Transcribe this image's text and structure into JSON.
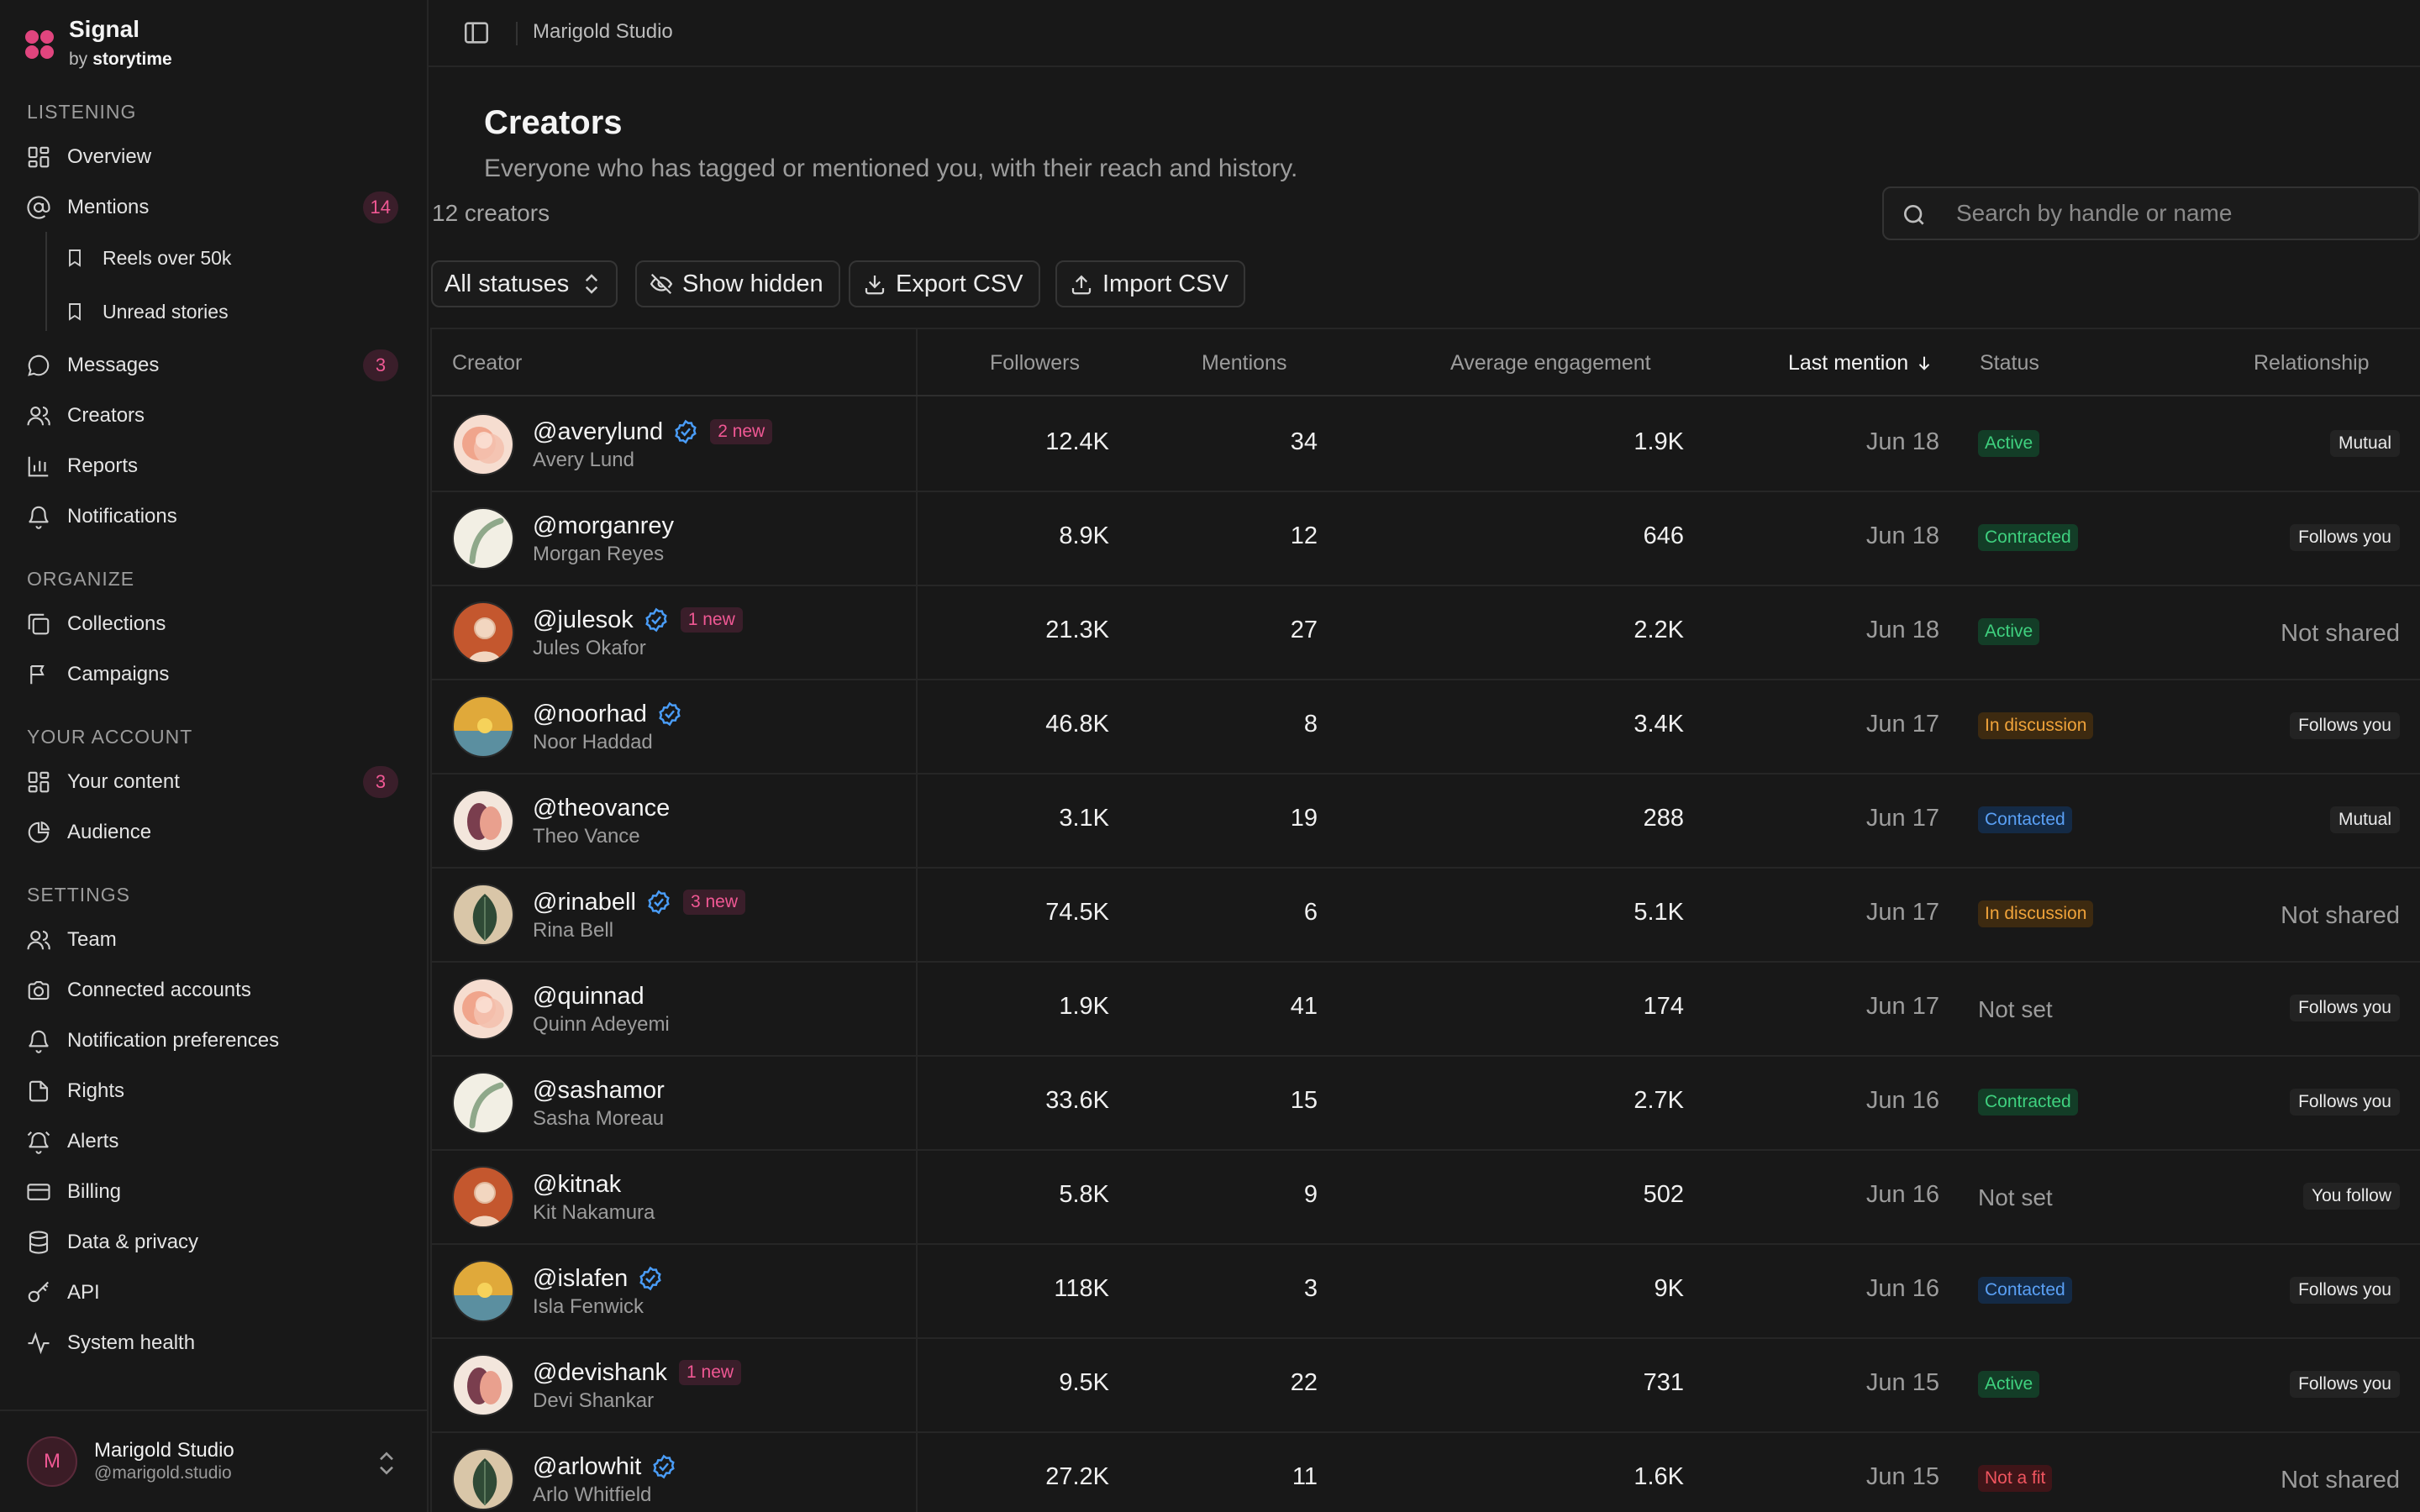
{
  "brand": {
    "name": "Signal",
    "by": "by",
    "company": "storytime"
  },
  "sidebar": {
    "sections": [
      {
        "title": "LISTENING"
      },
      {
        "title": "ORGANIZE"
      },
      {
        "title": "YOUR ACCOUNT"
      },
      {
        "title": "SETTINGS"
      }
    ],
    "listening": [
      {
        "label": "Overview",
        "icon": "grid-icon"
      },
      {
        "label": "Mentions",
        "icon": "at-icon",
        "badge": "14"
      },
      {
        "label": "Reels over 50k",
        "icon": "bookmark-icon"
      },
      {
        "label": "Unread stories",
        "icon": "bookmark-icon"
      },
      {
        "label": "Messages",
        "icon": "chat-icon",
        "badge": "3"
      },
      {
        "label": "Creators",
        "icon": "users-icon"
      },
      {
        "label": "Reports",
        "icon": "bar-chart-icon"
      },
      {
        "label": "Notifications",
        "icon": "bell-icon"
      }
    ],
    "organize": [
      {
        "label": "Collections",
        "icon": "collections-icon"
      },
      {
        "label": "Campaigns",
        "icon": "flag-icon"
      }
    ],
    "account": [
      {
        "label": "Your content",
        "icon": "grid-icon",
        "badge": "3"
      },
      {
        "label": "Audience",
        "icon": "pie-icon"
      }
    ],
    "settings": [
      {
        "label": "Team",
        "icon": "users-icon"
      },
      {
        "label": "Connected accounts",
        "icon": "camera-icon"
      },
      {
        "label": "Notification preferences",
        "icon": "bell-icon"
      },
      {
        "label": "Rights",
        "icon": "document-icon"
      },
      {
        "label": "Alerts",
        "icon": "alarm-icon"
      },
      {
        "label": "Billing",
        "icon": "credit-card-icon"
      },
      {
        "label": "Data & privacy",
        "icon": "database-icon"
      },
      {
        "label": "API",
        "icon": "key-icon"
      },
      {
        "label": "System health",
        "icon": "activity-icon"
      }
    ],
    "user": {
      "initial": "M",
      "name": "Marigold Studio",
      "handle": "@marigold.studio"
    }
  },
  "topbar": {
    "breadcrumb": "Marigold Studio"
  },
  "page": {
    "title": "Creators",
    "subtitle": "Everyone who has tagged or mentioned you, with their reach and history.",
    "count": "12 creators",
    "search_placeholder": "Search by handle or name"
  },
  "toolbar": {
    "status_filter": "All statuses",
    "show_hidden": "Show hidden",
    "export": "Export CSV",
    "import": "Import CSV"
  },
  "table": {
    "columns": {
      "creator": "Creator",
      "followers": "Followers",
      "mentions": "Mentions",
      "engagement": "Average engagement",
      "last_mention": "Last mention",
      "status": "Status",
      "relationship": "Relationship"
    },
    "rows": [
      {
        "handle": "@averylund",
        "name": "Avery Lund",
        "verified": true,
        "new": "2 new",
        "avatar": "peach",
        "followers": "12.4K",
        "mentions": "34",
        "engagement": "1.9K",
        "last": "Jun 18",
        "status": "Active",
        "relationship": "Mutual"
      },
      {
        "handle": "@morganrey",
        "name": "Morgan Reyes",
        "verified": false,
        "new": "",
        "avatar": "leaf-arc",
        "followers": "8.9K",
        "mentions": "12",
        "engagement": "646",
        "last": "Jun 18",
        "status": "Contracted",
        "relationship": "Follows you"
      },
      {
        "handle": "@julesok",
        "name": "Jules Okafor",
        "verified": true,
        "new": "1 new",
        "avatar": "person",
        "followers": "21.3K",
        "mentions": "27",
        "engagement": "2.2K",
        "last": "Jun 18",
        "status": "Active",
        "relationship": "Not shared"
      },
      {
        "handle": "@noorhad",
        "name": "Noor Haddad",
        "verified": true,
        "new": "",
        "avatar": "sunset",
        "followers": "46.8K",
        "mentions": "8",
        "engagement": "3.4K",
        "last": "Jun 17",
        "status": "In discussion",
        "relationship": "Follows you"
      },
      {
        "handle": "@theovance",
        "name": "Theo Vance",
        "verified": false,
        "new": "",
        "avatar": "shapes",
        "followers": "3.1K",
        "mentions": "19",
        "engagement": "288",
        "last": "Jun 17",
        "status": "Contacted",
        "relationship": "Mutual"
      },
      {
        "handle": "@rinabell",
        "name": "Rina Bell",
        "verified": true,
        "new": "3 new",
        "avatar": "leaf",
        "followers": "74.5K",
        "mentions": "6",
        "engagement": "5.1K",
        "last": "Jun 17",
        "status": "In discussion",
        "relationship": "Not shared"
      },
      {
        "handle": "@quinnad",
        "name": "Quinn Adeyemi",
        "verified": false,
        "new": "",
        "avatar": "peach",
        "followers": "1.9K",
        "mentions": "41",
        "engagement": "174",
        "last": "Jun 17",
        "status": "Not set",
        "relationship": "Follows you"
      },
      {
        "handle": "@sashamor",
        "name": "Sasha Moreau",
        "verified": false,
        "new": "",
        "avatar": "leaf-arc",
        "followers": "33.6K",
        "mentions": "15",
        "engagement": "2.7K",
        "last": "Jun 16",
        "status": "Contracted",
        "relationship": "Follows you"
      },
      {
        "handle": "@kitnak",
        "name": "Kit Nakamura",
        "verified": false,
        "new": "",
        "avatar": "person",
        "followers": "5.8K",
        "mentions": "9",
        "engagement": "502",
        "last": "Jun 16",
        "status": "Not set",
        "relationship": "You follow"
      },
      {
        "handle": "@islafen",
        "name": "Isla Fenwick",
        "verified": true,
        "new": "",
        "avatar": "sunset",
        "followers": "118K",
        "mentions": "3",
        "engagement": "9K",
        "last": "Jun 16",
        "status": "Contacted",
        "relationship": "Follows you"
      },
      {
        "handle": "@devishank",
        "name": "Devi Shankar",
        "verified": false,
        "new": "1 new",
        "avatar": "shapes",
        "followers": "9.5K",
        "mentions": "22",
        "engagement": "731",
        "last": "Jun 15",
        "status": "Active",
        "relationship": "Follows you"
      },
      {
        "handle": "@arlowhit",
        "name": "Arlo Whitfield",
        "verified": true,
        "new": "",
        "avatar": "leaf",
        "followers": "27.2K",
        "mentions": "11",
        "engagement": "1.6K",
        "last": "Jun 15",
        "status": "Not a fit",
        "relationship": "Not shared"
      }
    ]
  },
  "colors": {
    "accent": "#f05894",
    "active": "#3fd17f",
    "contracted": "#3fd17f",
    "in_discussion": "#f0a33a",
    "contacted": "#5aa0f5",
    "not_a_fit": "#f0555f",
    "verified": "#4a9df8"
  }
}
